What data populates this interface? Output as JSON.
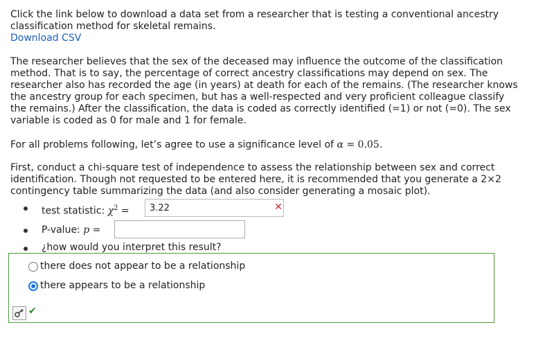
{
  "intro": {
    "instruction": "Click the link below to download a data set from a researcher that is testing a conventional ancestry classification method for skeletal remains.",
    "download_link": "Download CSV"
  },
  "description": "The researcher believes that the sex of the deceased may influence the outcome of the classification method.  That is to say, the percentage of correct ancestry classifications may depend on sex.  The researcher also has recorded the age (in years) at death for each of the remains.  (The researcher knows the ancestry group for each specimen, but has a well-respected and very proficient colleague classify the remains.) After the classification, the data is coded as correctly identified (=1) or not (=0).  The sex variable is coded as 0 for male and 1 for female.",
  "significance": {
    "text_before": "For all problems following, let’s agree to use a significance level of ",
    "symbol": "α",
    "equals": " = ",
    "value": "0.05",
    "period": "."
  },
  "task": "First, conduct a chi-square test of independence to assess the relationship between sex and correct identification.  Though not requested to be entered here, it is recommended that you generate a 2×2 contingency table summarizing the data (and also consider generating a mosaic plot).",
  "questions": {
    "test_statistic": {
      "label": "test statistic: ",
      "symbol": "χ",
      "superscript": "2",
      "equals": " =",
      "value": "3.22",
      "status": "incorrect"
    },
    "p_value": {
      "label": "P-value: ",
      "symbol": "p",
      "equals": " =",
      "value": ""
    },
    "interpret": {
      "label": "¿how would you interpret this result?"
    }
  },
  "answer": {
    "options": [
      {
        "label": "there does not appear to be a relationship",
        "selected": false
      },
      {
        "label": "there appears to be a relationship",
        "selected": true
      }
    ],
    "status": "correct"
  },
  "colors": {
    "link": "#1a5fb4",
    "correct_border": "#4a9a3b",
    "incorrect_mark": "#c0282d",
    "radio_selected": "#1a73e8"
  },
  "icons": {
    "key": "key-icon",
    "correct": "checkmark-icon",
    "incorrect": "x-mark-icon"
  }
}
